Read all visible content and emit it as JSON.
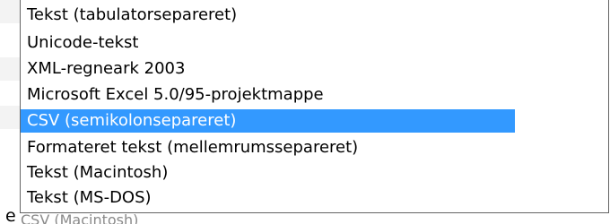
{
  "dropdown": {
    "options": [
      {
        "label": "Tekst (tabulatorseparere​t)",
        "selected": false
      },
      {
        "label": "Unicode-tekst",
        "selected": false
      },
      {
        "label": "XML-regneark 2003",
        "selected": false
      },
      {
        "label": "Microsoft Excel 5.0/95-projektmappe",
        "selected": false
      },
      {
        "label": "CSV (semikolonsepareret)",
        "selected": true
      },
      {
        "label": "Formateret tekst (mellemrumssepareret)",
        "selected": false
      },
      {
        "label": "Tekst (Macintosh)",
        "selected": false
      },
      {
        "label": "Tekst (MS-DOS)",
        "selected": false
      }
    ],
    "selected_color": "#3399ff",
    "border_color": "#646464"
  },
  "background": {
    "clipped_label_fragment": "e",
    "partially_hidden_item": "CSV (Macintosh)"
  }
}
